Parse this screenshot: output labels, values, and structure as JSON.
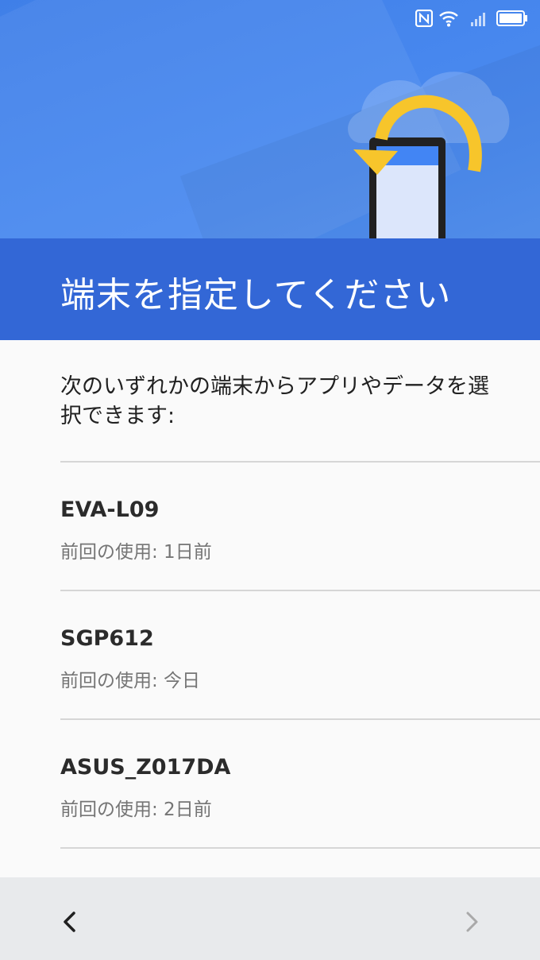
{
  "header": {
    "title": "端末を指定してください"
  },
  "description": "次のいずれかの端末からアプリやデータを選択できます:",
  "devices": [
    {
      "name": "EVA-L09",
      "last_used": "前回の使用: 1日前"
    },
    {
      "name": "SGP612",
      "last_used": "前回の使用: 今日"
    },
    {
      "name": "ASUS_Z017DA",
      "last_used": "前回の使用: 2日前"
    }
  ],
  "navigation": {
    "back_icon": "chevron-left-icon",
    "next_icon": "chevron-right-icon"
  },
  "status_bar": {
    "icons": [
      "nfc-icon",
      "wifi-icon",
      "signal-icon",
      "battery-icon"
    ]
  },
  "colors": {
    "header_background": "#4a8af0",
    "title_band": "#3367d6",
    "arrow": "#f7c52b",
    "nav_bar": "#e8eaec"
  }
}
